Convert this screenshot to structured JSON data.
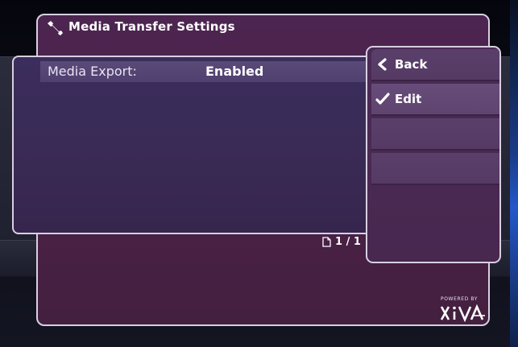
{
  "window": {
    "title": "Media Transfer Settings",
    "title_icon": "wrench-icon"
  },
  "list": {
    "rows": [
      {
        "label": "Media Export:",
        "value": "Enabled"
      }
    ]
  },
  "pagination": {
    "text": "1 / 1",
    "icon": "page-icon"
  },
  "side_menu": {
    "items": [
      {
        "label": "Back",
        "icon": "chevron-left-icon"
      },
      {
        "label": "Edit",
        "icon": "checkmark-icon"
      },
      {
        "label": ""
      },
      {
        "label": ""
      }
    ]
  },
  "logo": {
    "tagline": "POWERED BY",
    "name": "XiVA"
  },
  "colors": {
    "panel_border": "#d8cfe2",
    "panel_purple": "#4a2148",
    "list_bg": "#3a2b56",
    "row_highlight": "#5a4a78",
    "menu_item": "#5a3f6b"
  }
}
